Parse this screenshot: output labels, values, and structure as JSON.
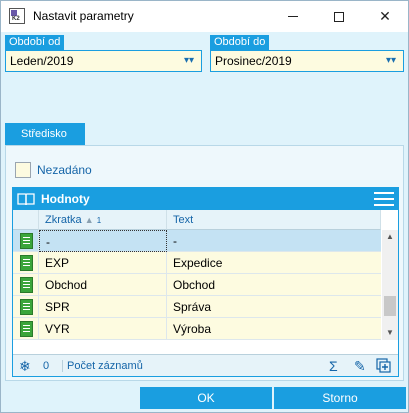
{
  "window": {
    "title": "Nastavit parametry"
  },
  "period_from": {
    "label": "Období od",
    "value": "Leden/2019"
  },
  "period_to": {
    "label": "Období do",
    "value": "Prosinec/2019"
  },
  "tab": {
    "label": "Středisko"
  },
  "checkbox": {
    "label": "Nezadáno",
    "checked": false
  },
  "grid": {
    "title": "Hodnoty",
    "columns": {
      "code": "Zkratka",
      "code_sort_index": "1",
      "text": "Text"
    },
    "rows": [
      {
        "code": "-",
        "text": "-"
      },
      {
        "code": "EXP",
        "text": "Expedice"
      },
      {
        "code": "Obchod",
        "text": "Obchod"
      },
      {
        "code": "SPR",
        "text": "Správa"
      },
      {
        "code": "VYR",
        "text": "Výroba"
      }
    ],
    "footer": {
      "count": "0",
      "count_label": "Počet záznamů"
    }
  },
  "buttons": {
    "ok": "OK",
    "storno": "Storno"
  },
  "colors": {
    "accent": "#1a9ee0",
    "background": "#dff3fb",
    "field_bg": "#fdfbe0"
  }
}
